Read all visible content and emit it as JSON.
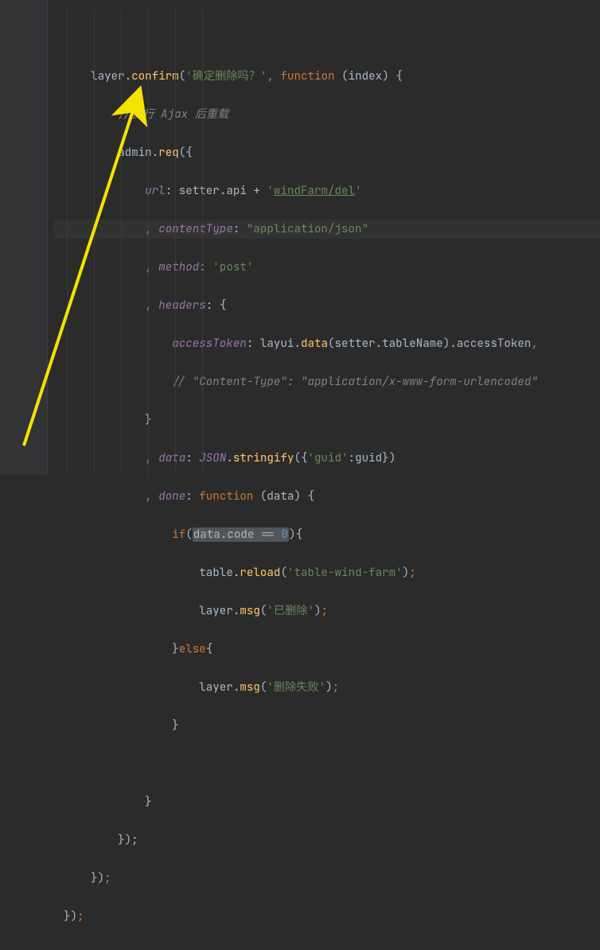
{
  "tokens": {
    "layer": "layer",
    "dot": ".",
    "confirm": "confirm",
    "open": "(",
    "close": ")",
    "obra": "{",
    "cbra": "}",
    "sq": "'",
    "confirm_str": "确定删除吗？",
    "comma": ", ",
    "func": "function ",
    "index": "index",
    "comment_ajax": "//执行 Ajax 后重载",
    "admin": "admin",
    "req": "req",
    "url": "url",
    "colon": ": ",
    "setter": "setter",
    "api": "api",
    "plus": " + ",
    "url_str": "windFarm/del",
    "lead_comma": ", ",
    "contentType": "contentType",
    "appjson": "\"application/json\"",
    "method": "method",
    "post": "'post'",
    "headers": "headers",
    "accessToken": "accessToken",
    "layui": "layui",
    "dataFn": "data",
    "tableName": "tableName",
    "comment_ct": "// \"Content-Type\": \"application/x-www-form-urlencoded\"",
    "data": "data",
    "JSON": "JSON",
    "stringify": "stringify",
    "guid_k": "'guid'",
    "guid_v": "guid",
    "done": "done",
    "if": "if",
    "code": "code",
    "eq": " == ",
    "zero": "0",
    "table": "table",
    "reload": "reload",
    "table_str": "'table-wind-farm'",
    "semi": ";",
    "msg": "msg",
    "deleted": "'已删除'",
    "else": "else",
    "delfail": "'删除失败'",
    "endreq": "});",
    "endconf": "});",
    "endouter": "});"
  }
}
